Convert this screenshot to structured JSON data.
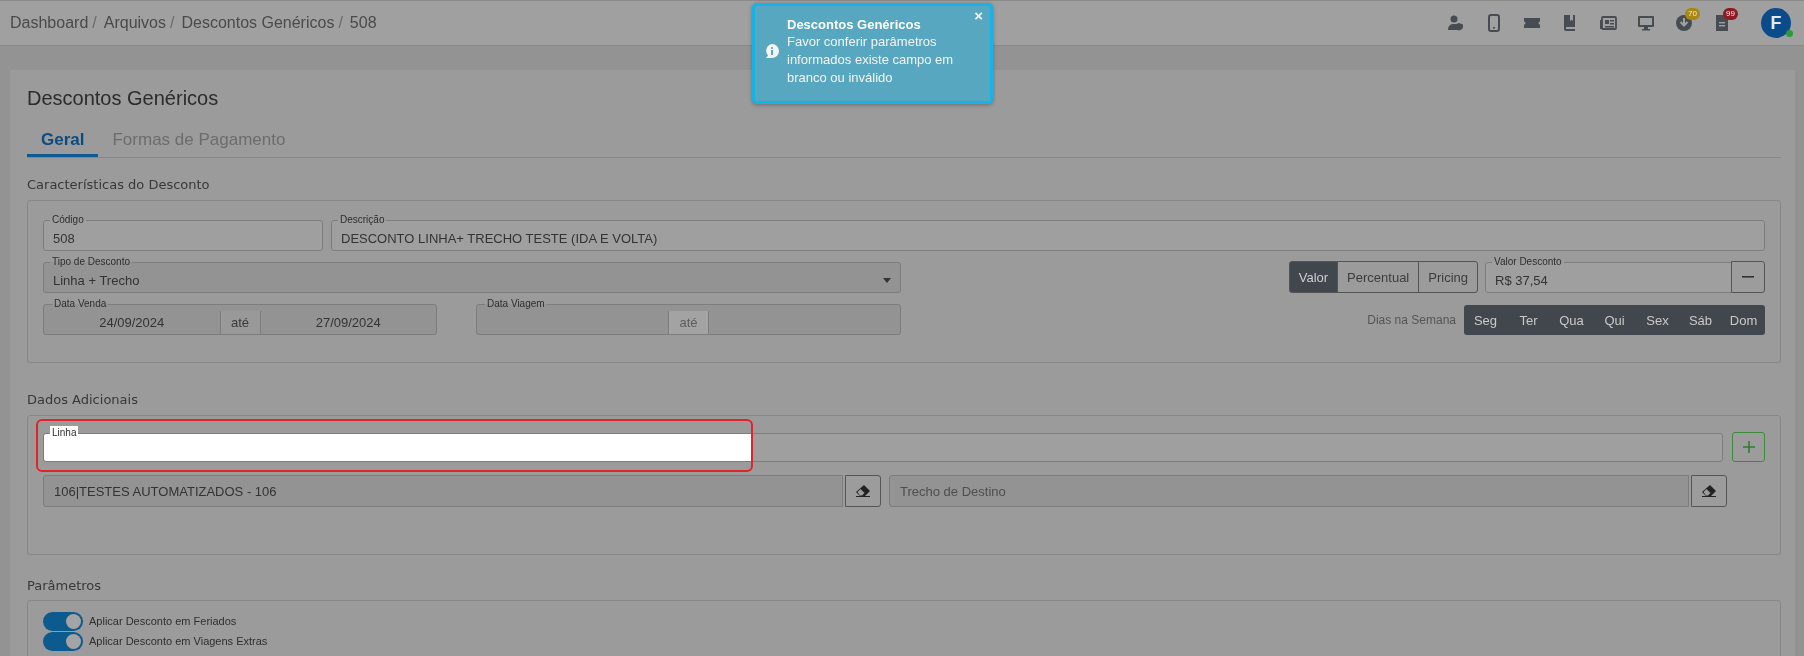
{
  "header": {
    "breadcrumb": [
      {
        "label": "Dashboard",
        "separator": "/"
      },
      {
        "label": "Arquivos",
        "separator": "/"
      },
      {
        "label": "Descontos Genéricos",
        "separator": "/"
      },
      {
        "label": "508"
      }
    ],
    "download_badge": "70",
    "documents_badge": "99",
    "avatar": "F",
    "online": true
  },
  "toast": {
    "title": "Descontos Genéricos",
    "message": "Favor conferir parâmetros informados existe campo em branco ou inválido",
    "close": "×"
  },
  "page": {
    "title": "Descontos Genéricos",
    "tabs": [
      {
        "label": "Geral",
        "selected": true
      },
      {
        "label": "Formas de Pagamento",
        "selected": false
      }
    ]
  },
  "caracteristicas": {
    "heading": "Características do Desconto",
    "codigo": {
      "label": "Código",
      "value": "508"
    },
    "descricao": {
      "label": "Descrição",
      "value": "DESCONTO LINHA+ TRECHO TESTE (IDA E VOLTA)"
    },
    "tipo": {
      "label": "Tipo de Desconto",
      "value": "Linha + Trecho"
    },
    "valor_tipo": [
      {
        "label": "Valor",
        "selected": true
      },
      {
        "label": "Percentual",
        "selected": false
      },
      {
        "label": "Pricing",
        "selected": false
      }
    ],
    "valor_desconto": {
      "label": "Valor Desconto",
      "value": "R$ 37,54"
    },
    "data_venda": {
      "label": "Data Venda",
      "from": "24/09/2024",
      "separator": "até",
      "to": "27/09/2024",
      "disabled": false
    },
    "data_viagem": {
      "label": "Data Viagem",
      "separator": "até",
      "disabled": true
    },
    "dias_label": "Dias na Semana",
    "dias": [
      {
        "label": "Seg",
        "selected": true
      },
      {
        "label": "Ter",
        "selected": true
      },
      {
        "label": "Qua",
        "selected": true
      },
      {
        "label": "Qui",
        "selected": true
      },
      {
        "label": "Sex",
        "selected": true
      },
      {
        "label": "Sáb",
        "selected": true
      },
      {
        "label": "Dom",
        "selected": true
      }
    ]
  },
  "dados_adicionais": {
    "heading": "Dados Adicionais",
    "linha": {
      "label": "Linha",
      "highlighted": true
    },
    "origem": {
      "value": "106|TESTES AUTOMATIZADOS - 106"
    },
    "destino": {
      "placeholder": "Trecho de Destino"
    }
  },
  "parametros": {
    "heading": "Parâmetros",
    "toggles": [
      {
        "label": "Aplicar Desconto em Feriados",
        "on": true
      },
      {
        "label": "Aplicar Desconto em Viagens Extras",
        "on": true
      }
    ]
  }
}
